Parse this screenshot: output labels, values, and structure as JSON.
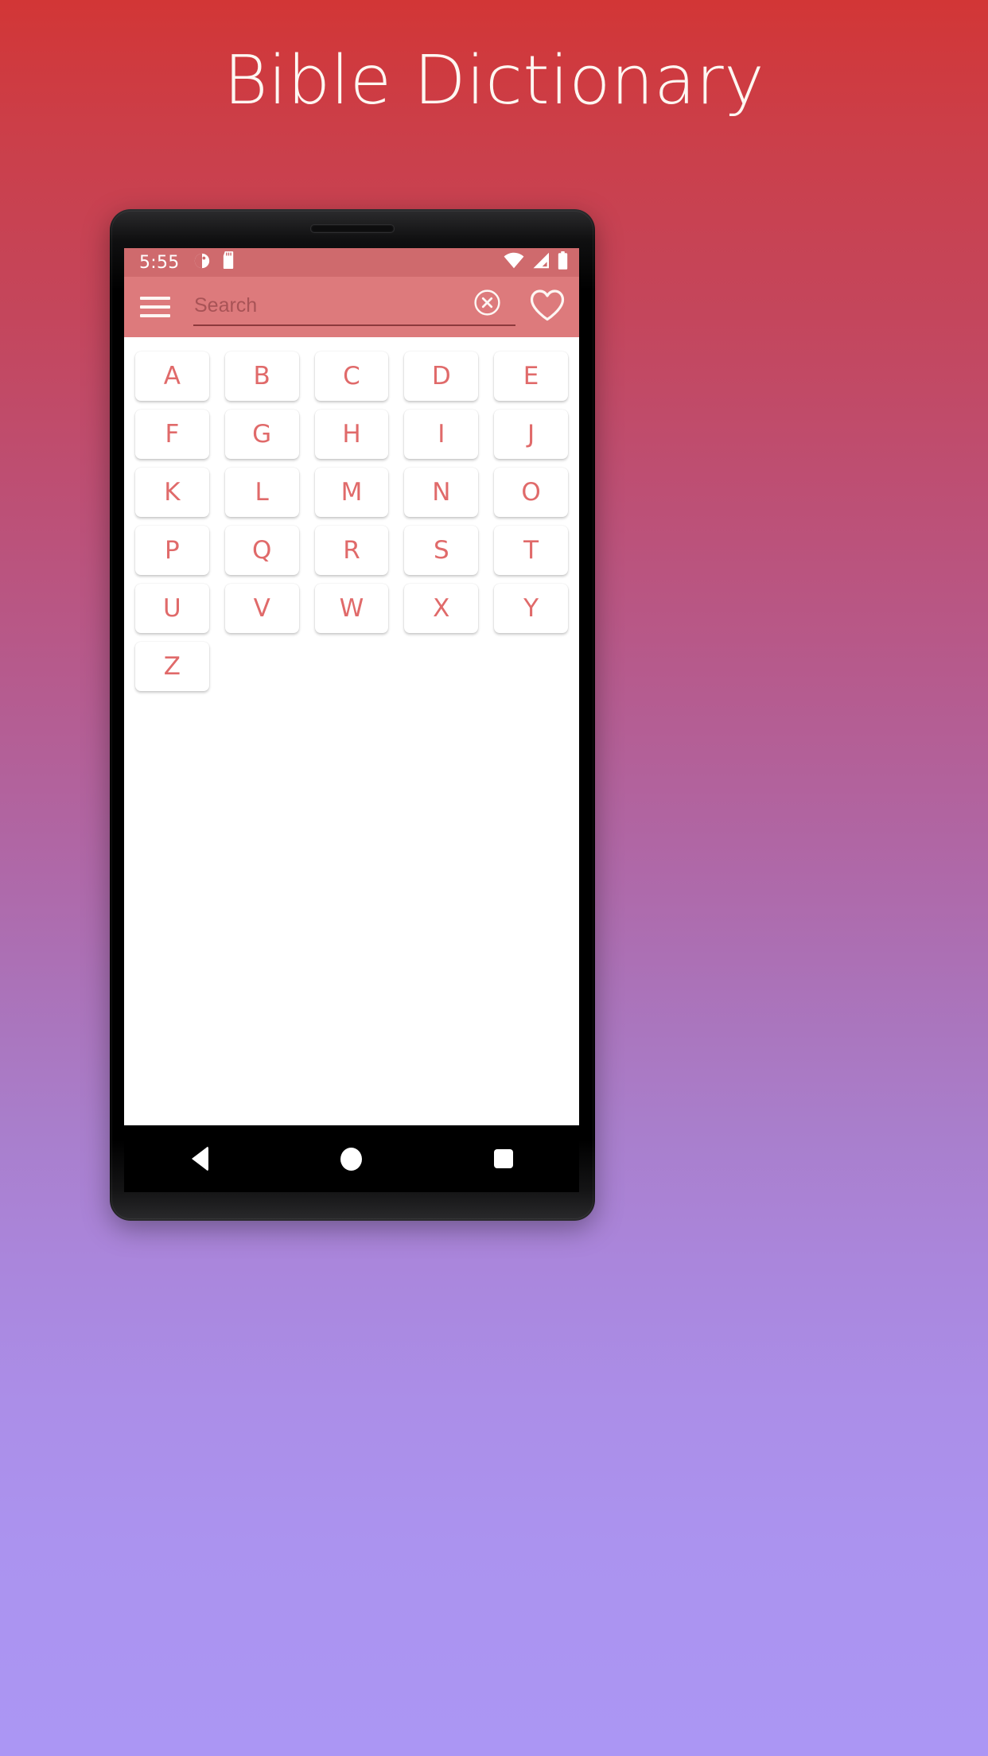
{
  "hero": {
    "title": "Bible Dictionary"
  },
  "phone": {
    "status_bar": {
      "time": "5:55",
      "left_icons": [
        "do-not-disturb-icon",
        "sd-card-icon"
      ],
      "right_icons": [
        "wifi-icon",
        "cellular-signal-icon",
        "battery-icon"
      ]
    },
    "app_bar": {
      "menu_icon": "hamburger-menu-icon",
      "search_placeholder": "Search",
      "search_value": "",
      "clear_icon": "clear-circle-x-icon",
      "favorites_icon": "heart-outline-icon"
    },
    "letters": [
      "A",
      "B",
      "C",
      "D",
      "E",
      "F",
      "G",
      "H",
      "I",
      "J",
      "K",
      "L",
      "M",
      "N",
      "O",
      "P",
      "Q",
      "R",
      "S",
      "T",
      "U",
      "V",
      "W",
      "X",
      "Y",
      "Z"
    ],
    "nav_bar": {
      "back_label": "back-triangle-icon",
      "home_label": "home-circle-icon",
      "recents_label": "recents-square-icon"
    }
  },
  "colors": {
    "gradient_top": "#d23636",
    "gradient_bottom": "#ab96f4",
    "status_bar": "#cf6a6d",
    "app_bar": "#dd7a7c",
    "letter_text": "#e06a6a",
    "title_text": "#fdf7f2",
    "screen_bg": "#ffffff",
    "nav_bar": "#000000"
  }
}
